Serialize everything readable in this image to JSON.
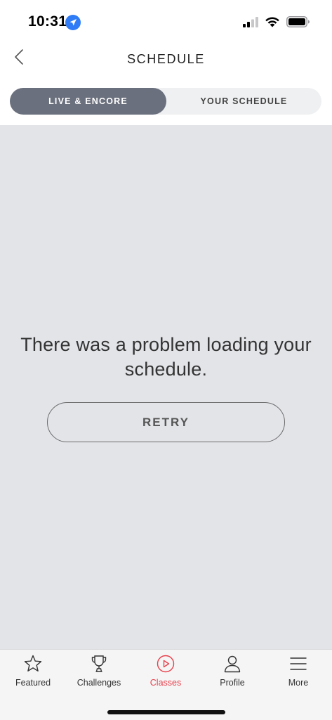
{
  "status_bar": {
    "time": "10:31",
    "icons": [
      "location-arrow-icon",
      "cellular-signal-icon",
      "wifi-icon",
      "battery-icon"
    ]
  },
  "nav": {
    "title": "SCHEDULE",
    "back_icon": "chevron-left-icon"
  },
  "segmented": {
    "tabs": [
      {
        "label": "LIVE & ENCORE",
        "selected": true
      },
      {
        "label": "YOUR SCHEDULE",
        "selected": false
      }
    ]
  },
  "content": {
    "error_message": "There was a problem loading your schedule.",
    "retry_label": "RETRY"
  },
  "tab_bar": {
    "items": [
      {
        "label": "Featured",
        "icon": "star-icon",
        "active": false
      },
      {
        "label": "Challenges",
        "icon": "trophy-icon",
        "active": false
      },
      {
        "label": "Classes",
        "icon": "play-circle-icon",
        "active": true
      },
      {
        "label": "Profile",
        "icon": "person-icon",
        "active": false
      },
      {
        "label": "More",
        "icon": "hamburger-menu-icon",
        "active": false
      }
    ]
  },
  "colors": {
    "accent": "#e8414b",
    "segment_active_bg": "#6a707d",
    "content_bg": "#e3e4e8",
    "location_blue": "#2f7cf6"
  }
}
